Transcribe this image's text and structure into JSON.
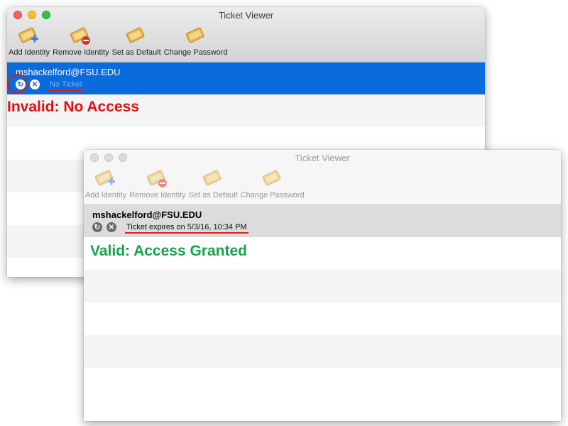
{
  "window_invalid": {
    "title": "Ticket Viewer",
    "toolbar": [
      {
        "label": "Add Identity",
        "icon": "add-identity-icon"
      },
      {
        "label": "Remove Identity",
        "icon": "remove-identity-icon"
      },
      {
        "label": "Set as Default",
        "icon": "set-default-icon"
      },
      {
        "label": "Change Password",
        "icon": "change-password-icon"
      }
    ],
    "identity": {
      "name": "mshackelford@FSU.EDU",
      "status": "No Ticket"
    },
    "annotation": "Invalid: No Access"
  },
  "window_valid": {
    "title": "Ticket Viewer",
    "toolbar": [
      {
        "label": "Add Identity",
        "icon": "add-identity-icon"
      },
      {
        "label": "Remove Identity",
        "icon": "remove-identity-icon"
      },
      {
        "label": "Set as Default",
        "icon": "set-default-icon"
      },
      {
        "label": "Change Password",
        "icon": "change-password-icon"
      }
    ],
    "identity": {
      "name": "mshackelford@FSU.EDU",
      "status": "Ticket expires on 5/3/16, 10:34 PM"
    },
    "annotation": "Valid: Access Granted"
  },
  "colors": {
    "selected_row": "#0a6bdc",
    "invalid_text": "#e01010",
    "valid_text": "#15a34a",
    "underline": "#e02020"
  }
}
